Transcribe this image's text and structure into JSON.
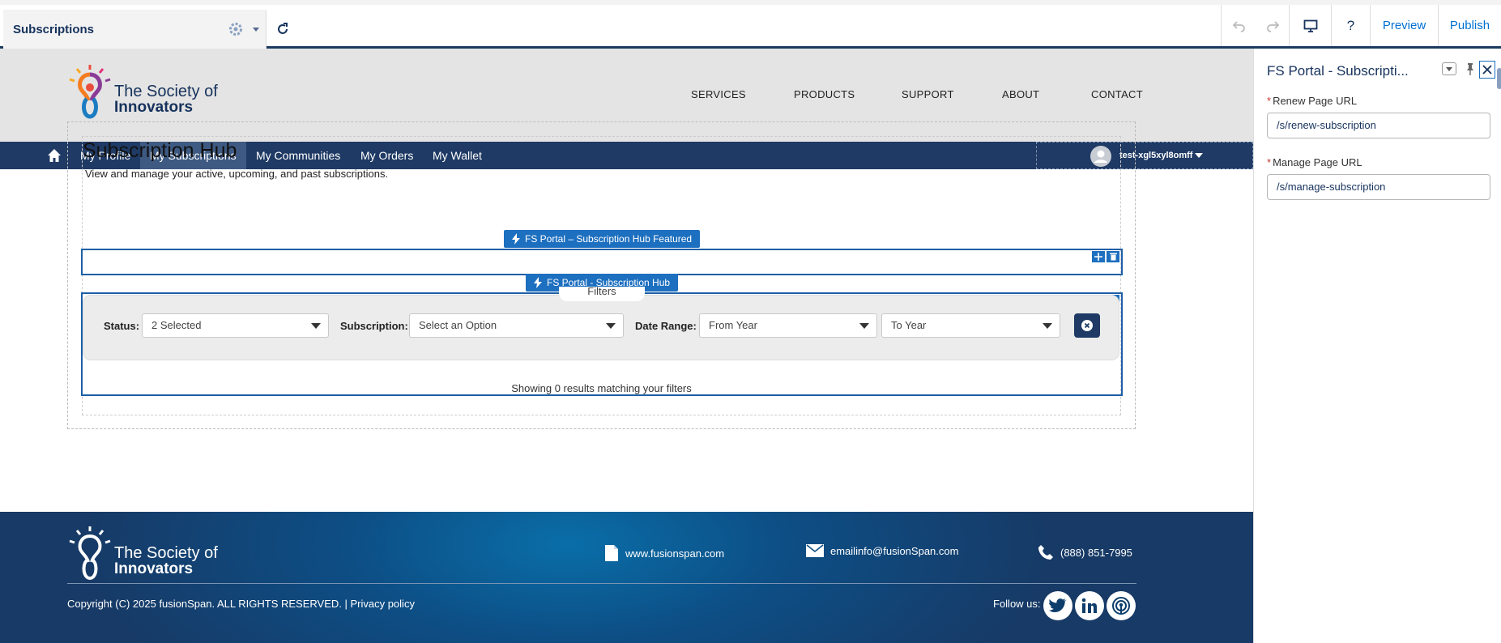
{
  "toolbar": {
    "page_name": "Subscriptions",
    "preview_label": "Preview",
    "publish_label": "Publish",
    "help_label": "?"
  },
  "header": {
    "logo_line1": "The Society of",
    "logo_line2": "Innovators",
    "nav": [
      "SERVICES",
      "PRODUCTS",
      "SUPPORT",
      "ABOUT",
      "CONTACT"
    ]
  },
  "subnav": {
    "items": [
      "My Profile",
      "My Subscriptions",
      "My Communities",
      "My Orders",
      "My Wallet"
    ],
    "active": "My Subscriptions",
    "username": "test-xgl5xyl8omff"
  },
  "hub": {
    "title": "Subscription Hub",
    "subtitle": "View and manage your active, upcoming, and past subscriptions.",
    "featured_component": "FS Portal – Subscription Hub Featured",
    "hub_component": "FS Portal - Subscription Hub",
    "filters_tab": "Filters",
    "status_label": "Status:",
    "status_value": "2 Selected",
    "subscription_label": "Subscription:",
    "subscription_value": "Select an Option",
    "date_range_label": "Date Range:",
    "from_year": "From Year",
    "to_year": "To Year",
    "results_text": "Showing 0 results matching your filters"
  },
  "footer": {
    "logo_line1": "The Society of",
    "logo_line2": "Innovators",
    "website": "www.fusionspan.com",
    "email": "emailinfo@fusionSpan.com",
    "phone": "(888) 851-7995",
    "copyright": "Copyright (C) 2025 fusionSpan. ALL RIGHTS RESERVED. | Privacy policy",
    "follow_label": "Follow us:"
  },
  "panel": {
    "title": "FS Portal - Subscripti...",
    "renew_label": "Renew Page URL",
    "renew_value": "/s/renew-subscription",
    "manage_label": "Manage Page URL",
    "manage_value": "/s/manage-subscription",
    "required_marker": "*"
  },
  "colors": {
    "nav_bg": "#1f3a64",
    "accent": "#1d6fbf",
    "header_bg": "#e4e4e4",
    "footer_bg": "#0d4e85"
  }
}
